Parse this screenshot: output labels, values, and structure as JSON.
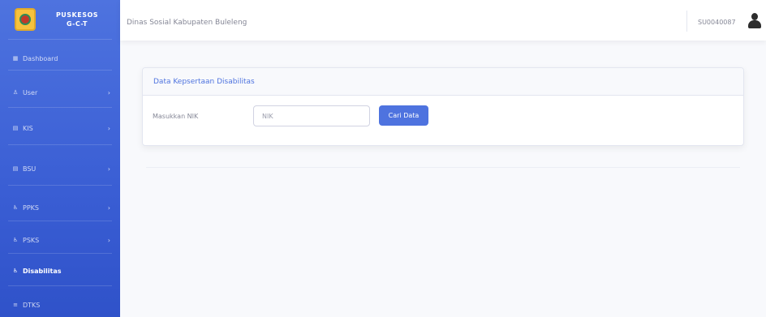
{
  "sidebar": {
    "brand_line1": "PUSKESOS",
    "brand_line2": "G-C-T",
    "items": [
      {
        "label": "Dashboard",
        "icon": "dashboard-icon",
        "glyph": "▦",
        "chevron": ""
      },
      {
        "label": "User",
        "icon": "user-icon",
        "glyph": "♙",
        "chevron": "›"
      },
      {
        "label": "KIS",
        "icon": "table-icon",
        "glyph": "▤",
        "chevron": "›"
      },
      {
        "label": "BSU",
        "icon": "table-icon",
        "glyph": "▤",
        "chevron": "›"
      },
      {
        "label": "PPKS",
        "icon": "wheelchair-icon",
        "glyph": "♿",
        "chevron": "›"
      },
      {
        "label": "PSKS",
        "icon": "wheelchair-icon",
        "glyph": "♿",
        "chevron": "›"
      },
      {
        "label": "Disabilitas",
        "icon": "wheelchair-icon",
        "glyph": "♿",
        "chevron": ""
      },
      {
        "label": "DTKS",
        "icon": "list-icon",
        "glyph": "≡",
        "chevron": ""
      }
    ]
  },
  "topbar": {
    "title": "Dinas Sosial Kabupaten Buleleng",
    "user_id": "SU0040087"
  },
  "card": {
    "title": "Data Kepsertaan Disabilitas",
    "nik_label": "Masukkan NIK",
    "nik_placeholder": "NIK",
    "nik_value": "",
    "search_button": "Cari Data"
  },
  "colors": {
    "sidebar": "#4e73df",
    "primary": "#4e73df",
    "background": "#f8f9fc"
  }
}
